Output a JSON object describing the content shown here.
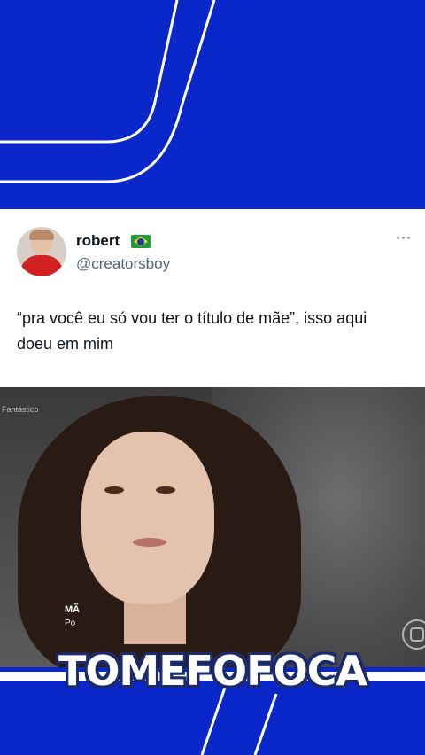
{
  "tweet": {
    "display_name": "robert",
    "flag": "brazil-flag-icon",
    "handle": "@creatorsboy",
    "text": "“pra você eu só vou ter o título de mãe”, isso aqui doeu em mim"
  },
  "video": {
    "channel_label": "Fantástico",
    "lower_third_title": "MÃ",
    "lower_third_subtitle": "Po"
  },
  "brand": {
    "caption": "TOMEFOFOCA"
  },
  "colors": {
    "background_blue": "#0a27c9",
    "card_white": "#ffffff",
    "handle_gray": "#536471"
  }
}
